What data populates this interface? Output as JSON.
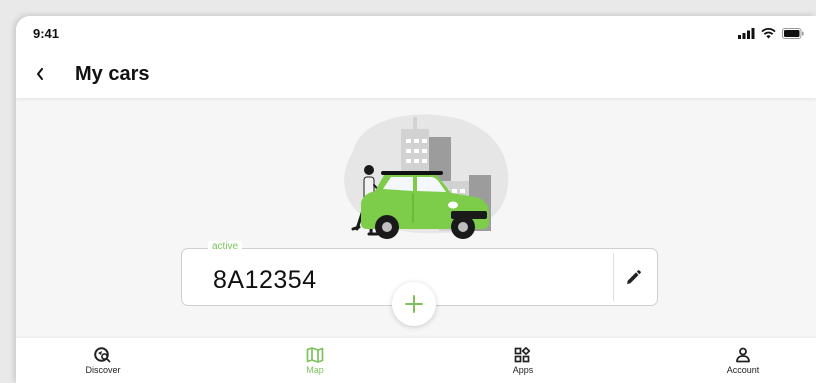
{
  "status_bar": {
    "time": "9:41"
  },
  "header": {
    "title": "My cars"
  },
  "car": {
    "status_label": "active",
    "plate_number": "8A12354"
  },
  "bottom_nav": {
    "items": [
      {
        "label": "Discover",
        "icon": "discover-icon",
        "active": false
      },
      {
        "label": "Map",
        "icon": "map-icon",
        "active": true
      },
      {
        "label": "Apps",
        "icon": "apps-icon",
        "active": false
      },
      {
        "label": "Account",
        "icon": "account-icon",
        "active": false
      }
    ]
  },
  "colors": {
    "accent": "#7cc35e",
    "car_body": "#7dcc4a",
    "text": "#111111",
    "background": "#f6f6f6"
  }
}
